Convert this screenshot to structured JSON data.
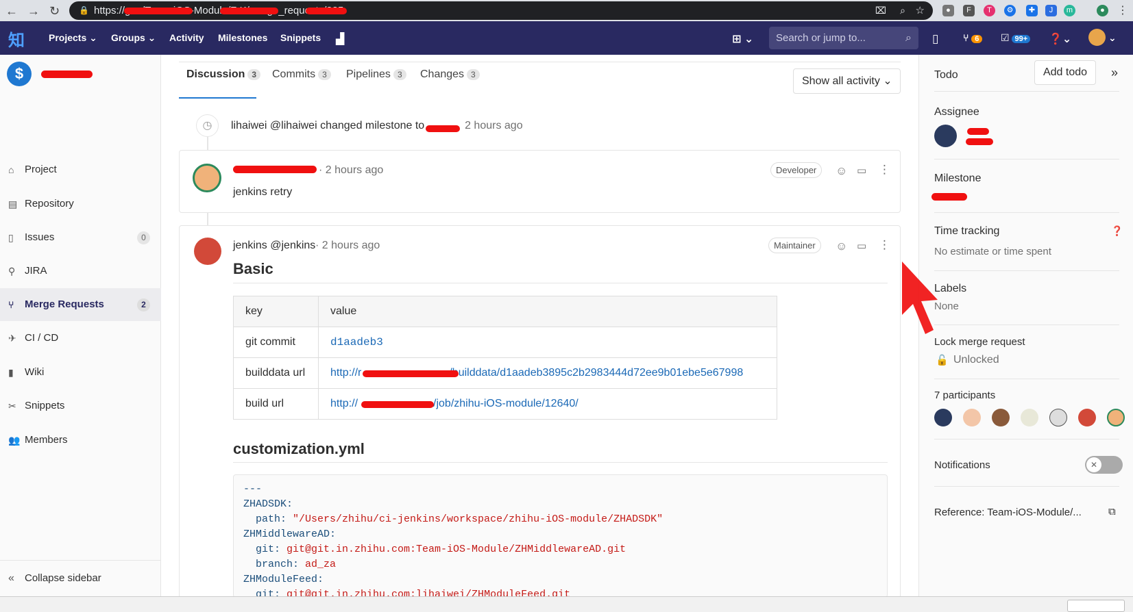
{
  "browser": {
    "url": "https://g            m/Team-iOS-Module/Z      K/merge_requests/225",
    "translate_icon": "translate-icon",
    "zoom_icon": "zoom-icon",
    "star_icon": "star-icon"
  },
  "header": {
    "logo": "知",
    "menu": [
      "Projects",
      "Groups",
      "Activity",
      "Milestones",
      "Snippets"
    ],
    "search_placeholder": "Search or jump to...",
    "mr_count": "6",
    "todo_count": "99+"
  },
  "sidebar": {
    "project_initial": "$",
    "items": [
      {
        "label": "Project",
        "icon": "home-icon"
      },
      {
        "label": "Repository",
        "icon": "doc-icon"
      },
      {
        "label": "Issues",
        "icon": "issues-icon",
        "count": "0"
      },
      {
        "label": "JIRA",
        "icon": "jira-icon"
      },
      {
        "label": "Merge Requests",
        "icon": "merge-icon",
        "count": "2"
      },
      {
        "label": "CI / CD",
        "icon": "rocket-icon"
      },
      {
        "label": "Wiki",
        "icon": "book-icon"
      },
      {
        "label": "Snippets",
        "icon": "scissors-icon"
      },
      {
        "label": "Members",
        "icon": "users-icon"
      }
    ],
    "collapse": "Collapse sidebar"
  },
  "tabs": [
    {
      "label": "Discussion",
      "count": "3"
    },
    {
      "label": "Commits",
      "count": "3"
    },
    {
      "label": "Pipelines",
      "count": "3"
    },
    {
      "label": "Changes",
      "count": "3"
    }
  ],
  "activity_filter": "Show all activity",
  "system_note": {
    "text": "lihaiwei @lihaiwei changed milestone to",
    "time": "2 hours ago"
  },
  "note1": {
    "time": "· 2 hours ago",
    "role": "Developer",
    "body": "jenkins retry"
  },
  "note2": {
    "author": "jenkins @jenkins",
    "time": "· 2 hours ago",
    "role": "Maintainer",
    "heading": "Basic",
    "table_header": [
      "key",
      "value"
    ],
    "rows": [
      {
        "key": "git commit",
        "value": "d1aadeb3"
      },
      {
        "key": "builddata url",
        "value_prefix": "http://r",
        "value_suffix": "/builddata/d1aadeb3895c2b2983444d72ee9b01ebe5e67998"
      },
      {
        "key": "build url",
        "value_prefix": "http://",
        "value_suffix": "/job/zhihu-iOS-module/12640/"
      }
    ],
    "heading2": "customization.yml",
    "code": [
      {
        "k": "---",
        "v": ""
      },
      {
        "k": "ZHADSDK:",
        "v": ""
      },
      {
        "k": "  path: ",
        "v": "\"/Users/zhihu/ci-jenkins/workspace/zhihu-iOS-module/ZHADSDK\""
      },
      {
        "k": "ZHMiddlewareAD:",
        "v": ""
      },
      {
        "k": "  git: ",
        "v": "git@git.in.zhihu.com:Team-iOS-Module/ZHMiddlewareAD.git"
      },
      {
        "k": "  branch: ",
        "v": "ad_za"
      },
      {
        "k": "ZHModuleFeed:",
        "v": ""
      },
      {
        "k": "  git: ",
        "v": "git@git.in.zhihu.com:lihaiwei/ZHModuleFeed.git"
      }
    ]
  },
  "right": {
    "todo": "Todo",
    "add_todo": "Add todo",
    "assignee": "Assignee",
    "milestone": "Milestone",
    "time_tracking": "Time tracking",
    "time_value": "No estimate or time spent",
    "labels": "Labels",
    "labels_value": "None",
    "lock": "Lock merge request",
    "lock_value": "Unlocked",
    "participants": "7 participants",
    "notifications": "Notifications",
    "reference": "Reference: Team-iOS-Module/..."
  },
  "colors": {
    "header": "#292961",
    "accent": "#1b69b6",
    "redact": "#f01010"
  }
}
